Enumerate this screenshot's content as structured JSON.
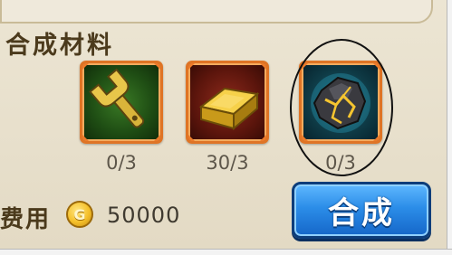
{
  "section": {
    "title": "合成材料"
  },
  "materials": [
    {
      "icon": "wrench-icon",
      "count": "0/3"
    },
    {
      "icon": "gold-bar-icon",
      "count": "30/3"
    },
    {
      "icon": "ore-stone-icon",
      "count": "0/3"
    }
  ],
  "cost": {
    "label": "费用",
    "coin_letter": "G",
    "amount": "50000"
  },
  "craft_button": {
    "label": "合成"
  },
  "colors": {
    "frame": "#df7425",
    "button": "#2b8de8",
    "background": "#e7dfcb"
  }
}
